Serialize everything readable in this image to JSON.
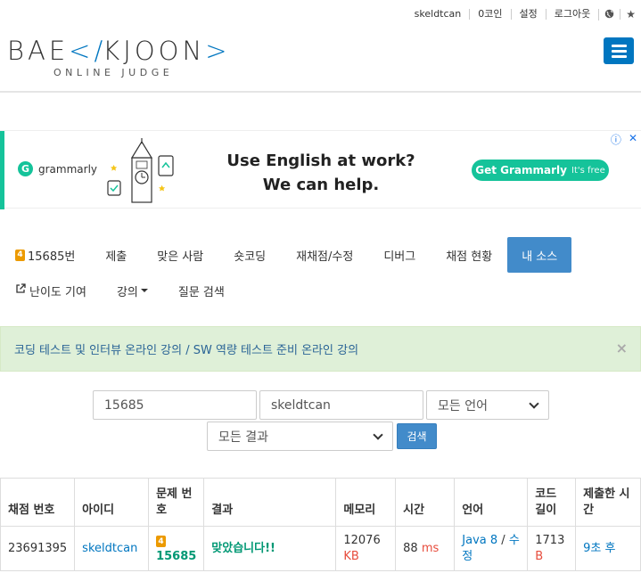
{
  "topbar": {
    "username": "skeldtcan",
    "coins": "0코인",
    "settings": "설정",
    "logout": "로그아웃"
  },
  "logo": {
    "main_left": "BAE",
    "main_mid": "K",
    "main_right": "JOON",
    "sub": "ONLINE JUDGE"
  },
  "ad": {
    "brand": "grammarly",
    "headline_line1": "Use English at work?",
    "headline_line2": "We can help.",
    "cta": "Get Grammarly",
    "cta_sub": "It's free",
    "colors": {
      "accent": "#15c39a"
    }
  },
  "nav": {
    "row1": [
      {
        "label": "15685번",
        "level": "4"
      },
      {
        "label": "제출"
      },
      {
        "label": "맞은 사람"
      },
      {
        "label": "숏코딩"
      },
      {
        "label": "재채점/수정"
      },
      {
        "label": "디버그"
      },
      {
        "label": "채점 현황"
      },
      {
        "label": "내 소스"
      }
    ],
    "row2": [
      {
        "label": "난이도 기여"
      },
      {
        "label": "강의"
      },
      {
        "label": "질문 검색"
      }
    ]
  },
  "alert": {
    "text": "코딩 테스트 및 인터뷰 온라인 강의 / SW 역량 테스트 준비 온라인 강의",
    "close": "×"
  },
  "search": {
    "problem_id": "15685",
    "user_id": "skeldtcan",
    "language": "모든 언어",
    "result": "모든 결과",
    "button": "검색"
  },
  "table": {
    "headers": [
      "채점 번호",
      "아이디",
      "문제 번호",
      "결과",
      "메모리",
      "시간",
      "언어",
      "코드 길이",
      "제출한 시간"
    ],
    "rows": [
      {
        "submission_id": "23691395",
        "user": "skeldtcan",
        "problem_level": "4",
        "problem_id": "15685",
        "result": "맞았습니다!!",
        "memory": "12076",
        "memory_unit": "KB",
        "time": "88",
        "time_unit": "ms",
        "language": "Java 8",
        "edit": "수정",
        "code_length": "1713",
        "code_unit": "B",
        "submitted": "9초 후"
      }
    ]
  }
}
